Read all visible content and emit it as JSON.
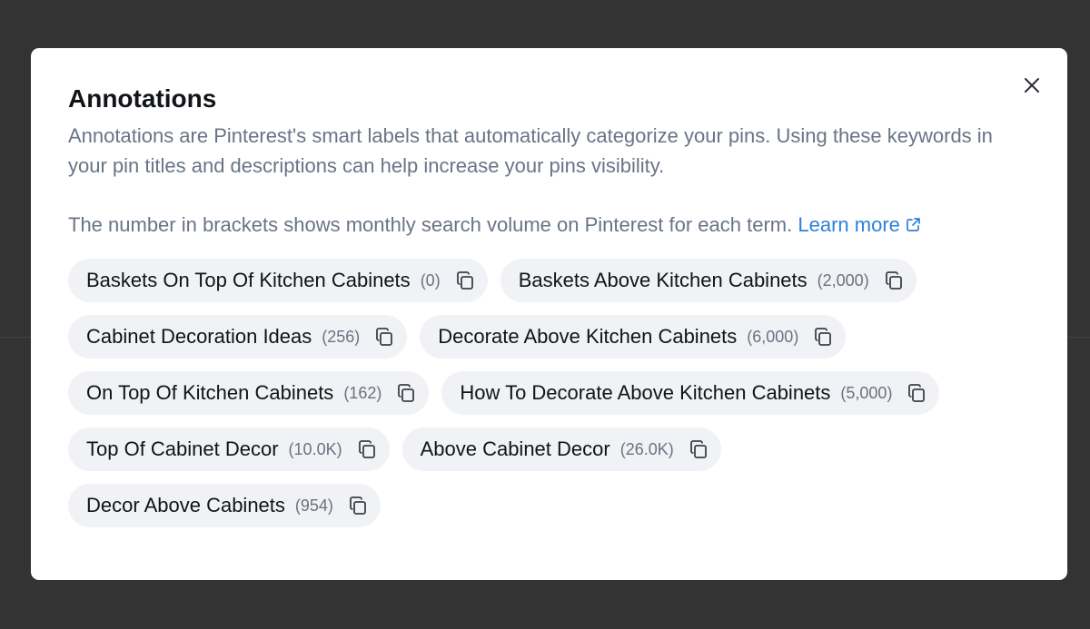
{
  "modal": {
    "title": "Annotations",
    "description": "Annotations are Pinterest's smart labels that automatically categorize your pins. Using these keywords in your pin titles and descriptions can help increase your pins visibility.",
    "search_volume_note": "The number in brackets shows monthly search volume on Pinterest for each term.",
    "learn_more_label": "Learn more",
    "close_icon": "close-icon",
    "external_link_icon": "external-link-icon",
    "copy_icon": "copy-icon"
  },
  "annotations": [
    {
      "label": "Baskets On Top Of Kitchen Cabinets",
      "count": "(0)"
    },
    {
      "label": "Baskets Above Kitchen Cabinets",
      "count": "(2,000)"
    },
    {
      "label": "Cabinet Decoration Ideas",
      "count": "(256)"
    },
    {
      "label": "Decorate Above Kitchen Cabinets",
      "count": "(6,000)"
    },
    {
      "label": "On Top Of Kitchen Cabinets",
      "count": "(162)"
    },
    {
      "label": "How To Decorate Above Kitchen Cabinets",
      "count": "(5,000)"
    },
    {
      "label": "Top Of Cabinet Decor",
      "count": "(10.0K)"
    },
    {
      "label": "Above Cabinet Decor",
      "count": "(26.0K)"
    },
    {
      "label": "Decor Above Cabinets",
      "count": "(954)"
    }
  ],
  "colors": {
    "backdrop": "#333333",
    "modal_bg": "#ffffff",
    "title": "#111418",
    "muted_text": "#697486",
    "link": "#2f80d8",
    "chip_bg": "#f0f2f5"
  }
}
